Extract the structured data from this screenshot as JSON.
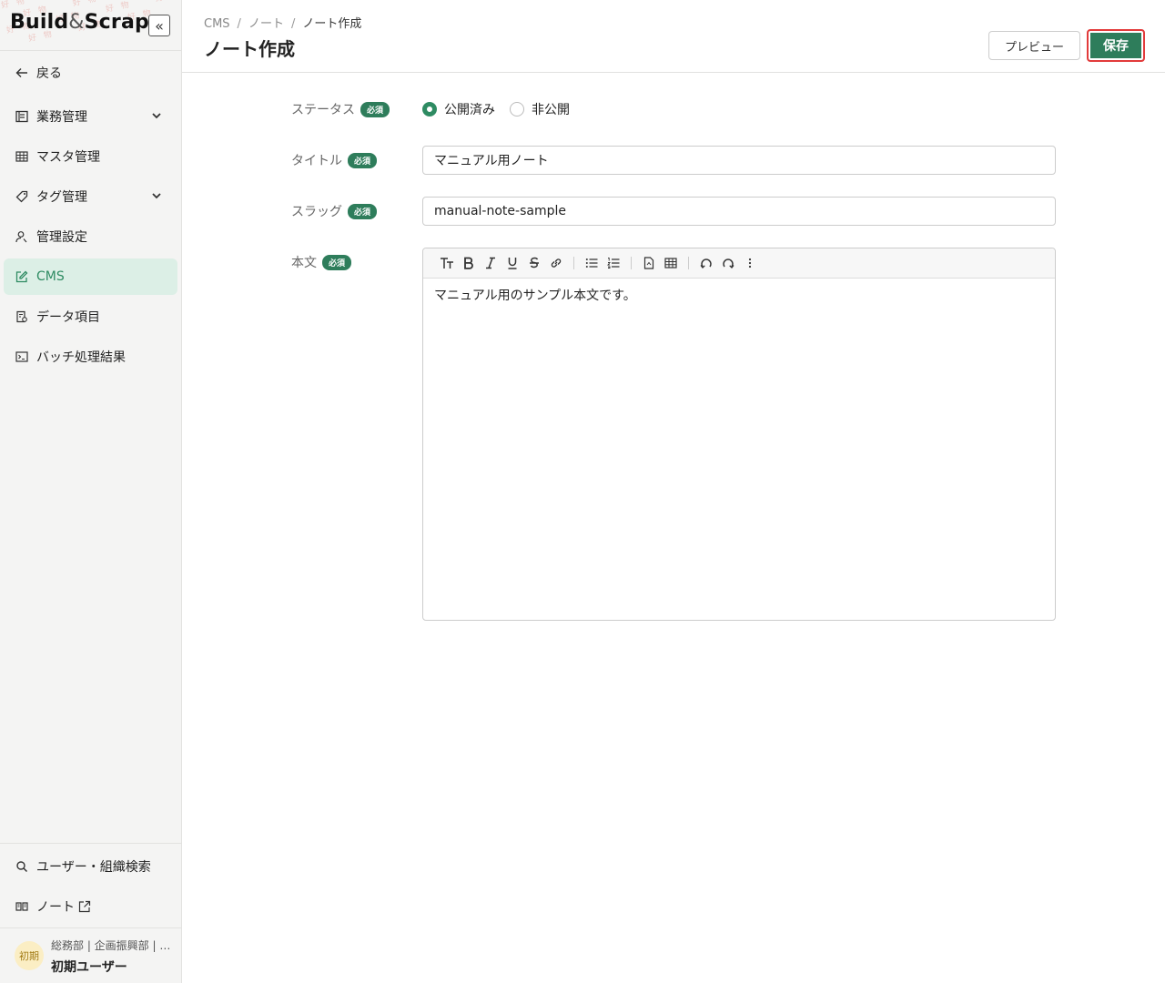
{
  "brand": {
    "name": "Build",
    "amp": "&",
    "name2": "Scrap",
    "collapse_icon": "«"
  },
  "sidebar": {
    "items": [
      {
        "label": "戻る",
        "icon": "arrow-left-icon"
      },
      {
        "label": "業務管理",
        "icon": "panel-icon",
        "chevron": true
      },
      {
        "label": "マスタ管理",
        "icon": "table-icon"
      },
      {
        "label": "タグ管理",
        "icon": "tag-icon",
        "chevron": true
      },
      {
        "label": "管理設定",
        "icon": "user-gear-icon"
      },
      {
        "label": "CMS",
        "icon": "edit-icon",
        "active": true
      },
      {
        "label": "データ項目",
        "icon": "document-icon"
      },
      {
        "label": "バッチ処理結果",
        "icon": "terminal-icon"
      }
    ],
    "bottom_items": [
      {
        "label": "ユーザー・組織検索",
        "icon": "search-icon"
      },
      {
        "label": "ノート",
        "icon": "book-icon",
        "external": true
      }
    ],
    "user": {
      "avatar": "初期",
      "org": "総務部 | 企画振興部 | …",
      "name": "初期ユーザー"
    }
  },
  "header": {
    "breadcrumb": [
      "CMS",
      "ノート",
      "ノート作成"
    ],
    "separator": "/",
    "title": "ノート作成",
    "preview_label": "プレビュー",
    "save_label": "保存"
  },
  "form": {
    "required_label": "必須",
    "status": {
      "label": "ステータス",
      "options": [
        "公開済み",
        "非公開"
      ],
      "selected": "公開済み"
    },
    "title": {
      "label": "タイトル",
      "value": "マニュアル用ノート"
    },
    "slug": {
      "label": "スラッグ",
      "value": "manual-note-sample"
    },
    "body": {
      "label": "本文",
      "value": "マニュアル用のサンプル本文です。"
    }
  },
  "colors": {
    "accent": "#2e7d5b",
    "active_bg": "#dcefe6",
    "highlight": "#e23b3b"
  }
}
